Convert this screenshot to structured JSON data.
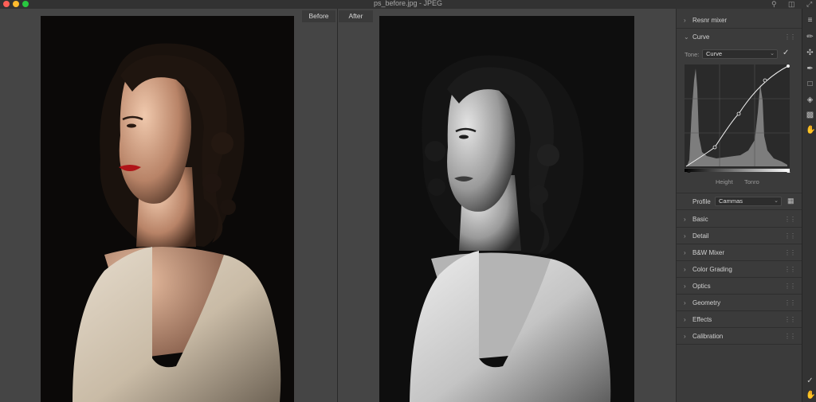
{
  "window": {
    "title": "ps_before.jpg - JPEG",
    "traffic_colors": [
      "#ff5f57",
      "#febc2e",
      "#28c840"
    ]
  },
  "view": {
    "tabs": [
      {
        "label": "Before"
      },
      {
        "label": "After"
      }
    ]
  },
  "panel": {
    "top_section": {
      "label": "Resnr mixer"
    },
    "curve": {
      "label": "Curve",
      "tone_label": "Tone:",
      "tone_value": "Curve",
      "axis_left": "Height",
      "axis_right": "Tonro"
    },
    "profile": {
      "label": "Profile",
      "value": "Cammas"
    },
    "sections": [
      {
        "label": "Basic"
      },
      {
        "label": "Detail"
      },
      {
        "label": "B&W Mixer"
      },
      {
        "label": "Color Grading"
      },
      {
        "label": "Optics"
      },
      {
        "label": "Geometry"
      },
      {
        "label": "Effects"
      },
      {
        "label": "Calibration"
      }
    ]
  },
  "icons": {
    "search": "search-icon",
    "panels": "panels-icon",
    "expand": "expand-icon"
  }
}
